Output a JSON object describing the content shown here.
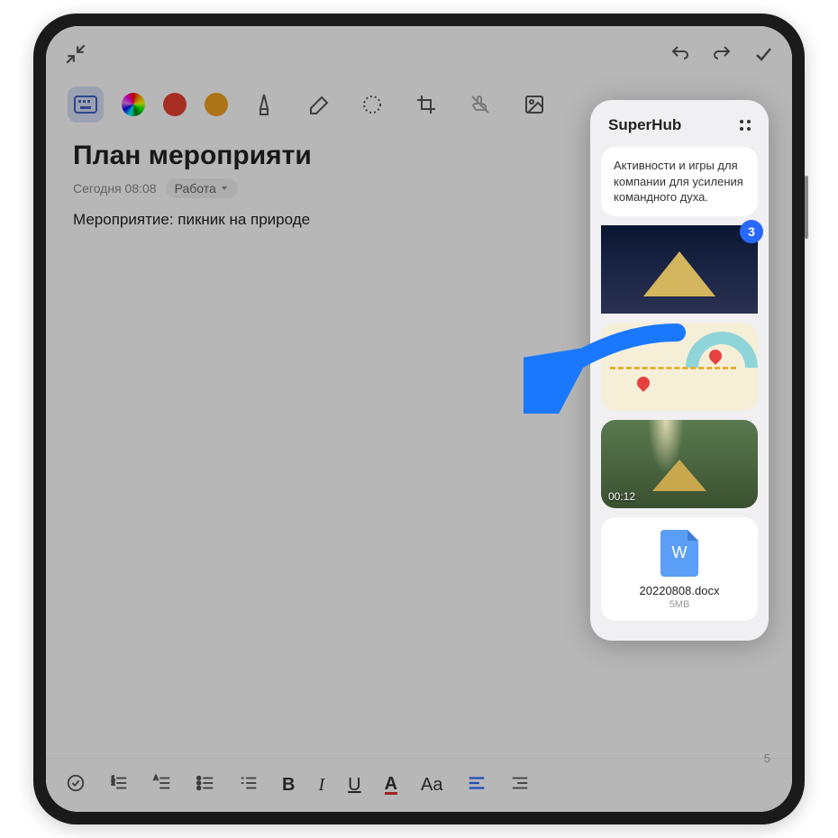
{
  "note": {
    "title": "План мероприяти",
    "timestamp": "Сегодня 08:08",
    "tag": "Работа",
    "body": "Мероприятие: пикник на природе",
    "page_number": "5"
  },
  "toolbar": {
    "colors": {
      "red": "#e84030",
      "orange": "#f0a020"
    }
  },
  "superhub": {
    "title": "SuperHub",
    "text_card": "Активности и игры для компании для усиления командного духа.",
    "badge_count": "3",
    "video_time": "00:12",
    "file": {
      "icon_letter": "W",
      "name": "20220808.docx",
      "size": "5MB"
    }
  },
  "format_bar": {
    "bold": "B",
    "italic": "I",
    "underline": "U",
    "color": "A",
    "size": "Aa"
  }
}
